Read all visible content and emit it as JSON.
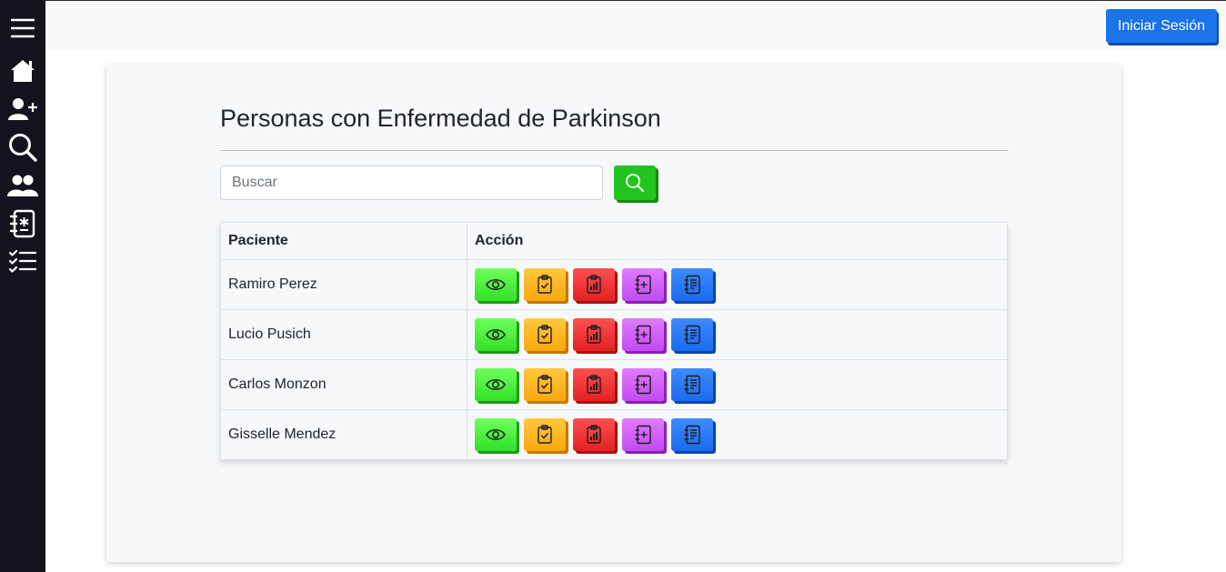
{
  "sidebar": {
    "items": [
      {
        "icon": "menu-icon"
      },
      {
        "icon": "home-icon"
      },
      {
        "icon": "add-user-icon"
      },
      {
        "icon": "search-icon"
      },
      {
        "icon": "people-icon"
      },
      {
        "icon": "journal-icon"
      },
      {
        "icon": "checklist-icon"
      }
    ]
  },
  "header": {
    "login_label": "Iniciar Sesión"
  },
  "main": {
    "title": "Personas con Enfermedad de Parkinson",
    "search": {
      "placeholder": "Buscar",
      "value": "",
      "button_icon": "search-icon"
    },
    "table": {
      "headers": [
        "Paciente",
        "Acción"
      ],
      "rows": [
        {
          "name": "Ramiro Perez"
        },
        {
          "name": "Lucio Pusich"
        },
        {
          "name": "Carlos Monzon"
        },
        {
          "name": "Gisselle Mendez"
        }
      ],
      "actions": [
        {
          "icon": "eye-icon",
          "color": "#34e028"
        },
        {
          "icon": "clipboard-check-icon",
          "color": "#fba70f"
        },
        {
          "icon": "clipboard-chart-icon",
          "color": "#e32121"
        },
        {
          "icon": "journal-plus-icon",
          "color": "#c34af0"
        },
        {
          "icon": "journal-text-icon",
          "color": "#1a6bef"
        }
      ]
    }
  },
  "colors": {
    "sidebar_bg": "#12131f",
    "primary": "#1a73e8",
    "search_green": "#22c51d"
  }
}
